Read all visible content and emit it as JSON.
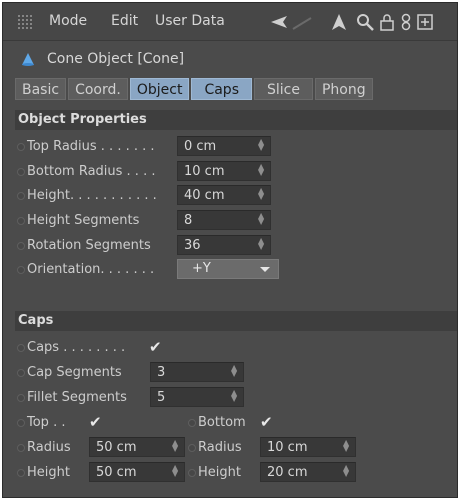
{
  "menubar": {
    "items": [
      "Mode",
      "Edit",
      "User Data"
    ]
  },
  "title": "Cone Object [Cone]",
  "tabs": [
    {
      "label": "Basic",
      "active": false
    },
    {
      "label": "Coord.",
      "active": false
    },
    {
      "label": "Object",
      "active": true
    },
    {
      "label": "Caps",
      "active": true
    },
    {
      "label": "Slice",
      "active": false
    },
    {
      "label": "Phong",
      "active": false
    }
  ],
  "object_properties": {
    "header": "Object Properties",
    "top_radius": {
      "label": "Top Radius . . . . . . .",
      "value": "0 cm"
    },
    "bottom_radius": {
      "label": "Bottom Radius . . . .",
      "value": "10 cm"
    },
    "height": {
      "label": "Height. . . . . . . . . . .",
      "value": "40 cm"
    },
    "height_segments": {
      "label": "Height Segments",
      "value": "8"
    },
    "rotation_segments": {
      "label": "Rotation Segments",
      "value": "36"
    },
    "orientation": {
      "label": "Orientation. . . . . . .",
      "value": "+Y"
    }
  },
  "caps": {
    "header": "Caps",
    "caps": {
      "label": "Caps . . . . . . . .",
      "checked": true
    },
    "cap_segments": {
      "label": "Cap Segments",
      "value": "3"
    },
    "fillet_segments": {
      "label": "Fillet Segments",
      "value": "5"
    },
    "top": {
      "label": "Top . .",
      "checked": true
    },
    "bottom": {
      "label": "Bottom",
      "checked": true
    },
    "top_radius": {
      "label": "Radius",
      "value": "50 cm"
    },
    "bottom_radius": {
      "label": "Radius",
      "value": "10 cm"
    },
    "top_height": {
      "label": "Height",
      "value": "50 cm"
    },
    "bottom_height": {
      "label": "Height",
      "value": "20 cm"
    }
  },
  "icons": [
    "grip-icon",
    "back-arrow-icon",
    "up-arrow-icon",
    "search-icon",
    "lock-icon",
    "link-icon",
    "new-window-icon",
    "cone-icon"
  ],
  "colors": {
    "panel": "#4b4b4b",
    "active_tab": "#8aa6c4",
    "section": "#3e3e3e",
    "field": "#383838"
  }
}
